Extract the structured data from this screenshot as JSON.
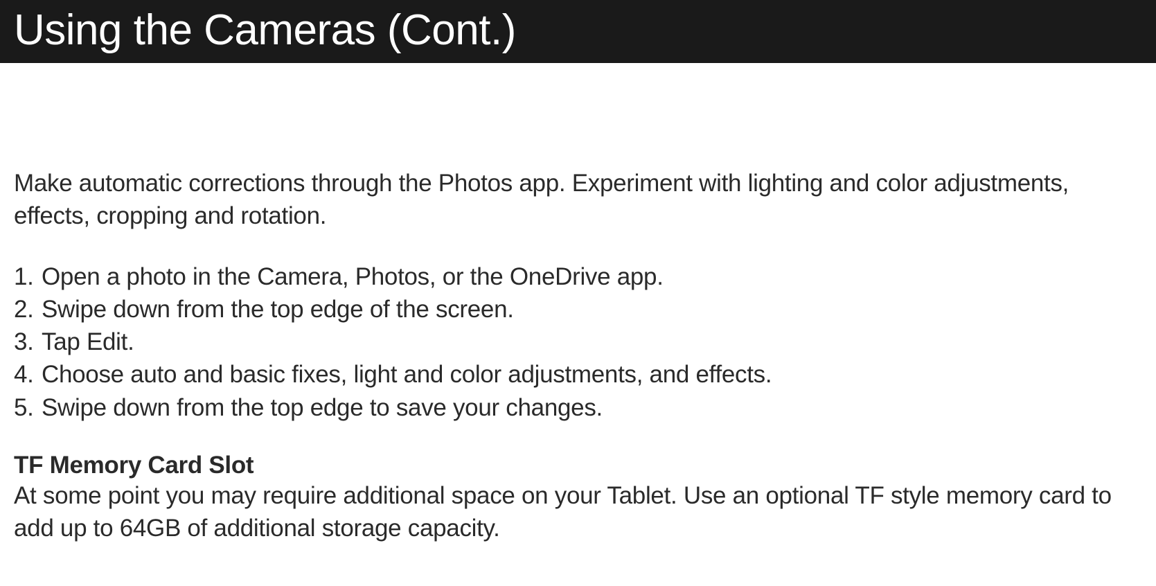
{
  "header": {
    "title": "Using the Cameras (Cont.)"
  },
  "intro": "Make automatic corrections through the Photos app. Experiment with lighting and color adjustments, effects, cropping and rotation.",
  "steps": [
    {
      "num": "1.",
      "text": "Open a photo in the Camera, Photos, or the OneDrive app."
    },
    {
      "num": "2.",
      "text": "Swipe down from the top edge of the screen."
    },
    {
      "num": "3.",
      "text": "Tap Edit."
    },
    {
      "num": "4.",
      "text": "Choose auto and basic fixes, light and color adjustments, and effects."
    },
    {
      "num": "5.",
      "text": "Swipe down from the top edge to save your changes."
    }
  ],
  "subsection": {
    "heading": "TF Memory Card Slot",
    "text": "At some point you may require additional space on your Tablet. Use an optional TF style memory card to add up to 64GB of additional storage capacity."
  }
}
